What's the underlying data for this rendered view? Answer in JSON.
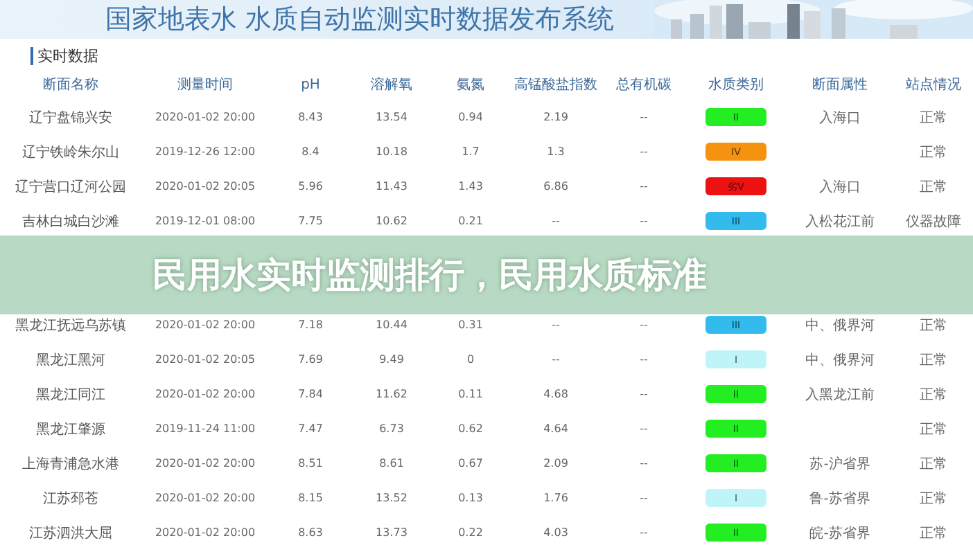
{
  "title": "国家地表水 水质自动监测实时数据发布系统",
  "section_title": "实时数据",
  "table": {
    "columns": [
      "断面名称",
      "测量时间",
      "pH",
      "溶解氧",
      "氨氮",
      "高锰酸盐指数",
      "总有机碳",
      "水质类别",
      "断面属性",
      "站点情况"
    ],
    "rows": [
      {
        "station": "辽宁盘锦兴安",
        "time": "2020-01-02 20:00",
        "ph": "8.43",
        "oxygen": "13.54",
        "ammonia": "0.94",
        "permanganate": "2.19",
        "carbon": "--",
        "grade": "II",
        "color": "#22ee22",
        "attribute": "入海口",
        "status": "正常"
      },
      {
        "station": "辽宁铁岭朱尔山",
        "time": "2019-12-26 12:00",
        "ph": "8.4",
        "oxygen": "10.18",
        "ammonia": "1.7",
        "permanganate": "1.3",
        "carbon": "--",
        "grade": "IV",
        "color": "#f5920f",
        "status": "正常"
      },
      {
        "station": "辽宁营口辽河公园",
        "time": "2020-01-02 20:05",
        "ph": "5.96",
        "oxygen": "11.43",
        "ammonia": "1.43",
        "permanganate": "6.86",
        "carbon": "--",
        "grade": "劣V",
        "color": "#ee1111",
        "attribute": "入海口",
        "status": "正常"
      },
      {
        "station": "吉林白城白沙滩",
        "time": "2019-12-01 08:00",
        "ph": "7.75",
        "oxygen": "10.62",
        "ammonia": "0.21",
        "permanganate": "--",
        "carbon": "--",
        "grade": "III",
        "color": "#33bbee",
        "attribute": "入松花江前",
        "status": "仪器故障"
      },
      {
        "station": "黑龙江抚远乌苏镇",
        "time": "2020-01-02 20:00",
        "ph": "7.18",
        "oxygen": "10.44",
        "ammonia": "0.31",
        "permanganate": "--",
        "carbon": "--",
        "grade": "III",
        "color": "#33bbee",
        "attribute": "中、俄界河",
        "status": "正常"
      },
      {
        "station": "黑龙江黑河",
        "time": "2020-01-02 20:05",
        "ph": "7.69",
        "oxygen": "9.49",
        "ammonia": "0",
        "permanganate": "--",
        "carbon": "--",
        "grade": "I",
        "color": "#bff5f8",
        "attribute": "中、俄界河",
        "status": "正常"
      },
      {
        "station": "黑龙江同江",
        "time": "2020-01-02 20:00",
        "ph": "7.84",
        "oxygen": "11.62",
        "ammonia": "0.11",
        "permanganate": "4.68",
        "carbon": "--",
        "grade": "II",
        "color": "#22ee22",
        "attribute": "入黑龙江前",
        "status": "正常"
      },
      {
        "station": "黑龙江肇源",
        "time": "2019-11-24 11:00",
        "ph": "7.47",
        "oxygen": "6.73",
        "ammonia": "0.62",
        "permanganate": "4.64",
        "carbon": "--",
        "grade": "II",
        "color": "#22ee22",
        "status": "正常"
      },
      {
        "station": "上海青浦急水港",
        "time": "2020-01-02 20:00",
        "ph": "8.51",
        "oxygen": "8.61",
        "ammonia": "0.67",
        "permanganate": "2.09",
        "carbon": "--",
        "grade": "II",
        "color": "#22ee22",
        "attribute": "苏-沪省界",
        "status": "正常"
      },
      {
        "station": "江苏邳苍",
        "time": "2020-01-02 20:00",
        "ph": "8.15",
        "oxygen": "13.52",
        "ammonia": "0.13",
        "permanganate": "1.76",
        "carbon": "--",
        "grade": "I",
        "color": "#bff5f8",
        "attribute": "鲁-苏省界",
        "status": "正常"
      },
      {
        "station": "江苏泗洪大屈",
        "time": "2020-01-02 20:00",
        "ph": "8.63",
        "oxygen": "13.73",
        "ammonia": "0.22",
        "permanganate": "4.03",
        "carbon": "--",
        "grade": "II",
        "color": "#22ee22",
        "attribute": "皖-苏省界",
        "status": "正常"
      }
    ]
  },
  "banner": {
    "text": "民用水实时监测排行，民用水质标准"
  }
}
